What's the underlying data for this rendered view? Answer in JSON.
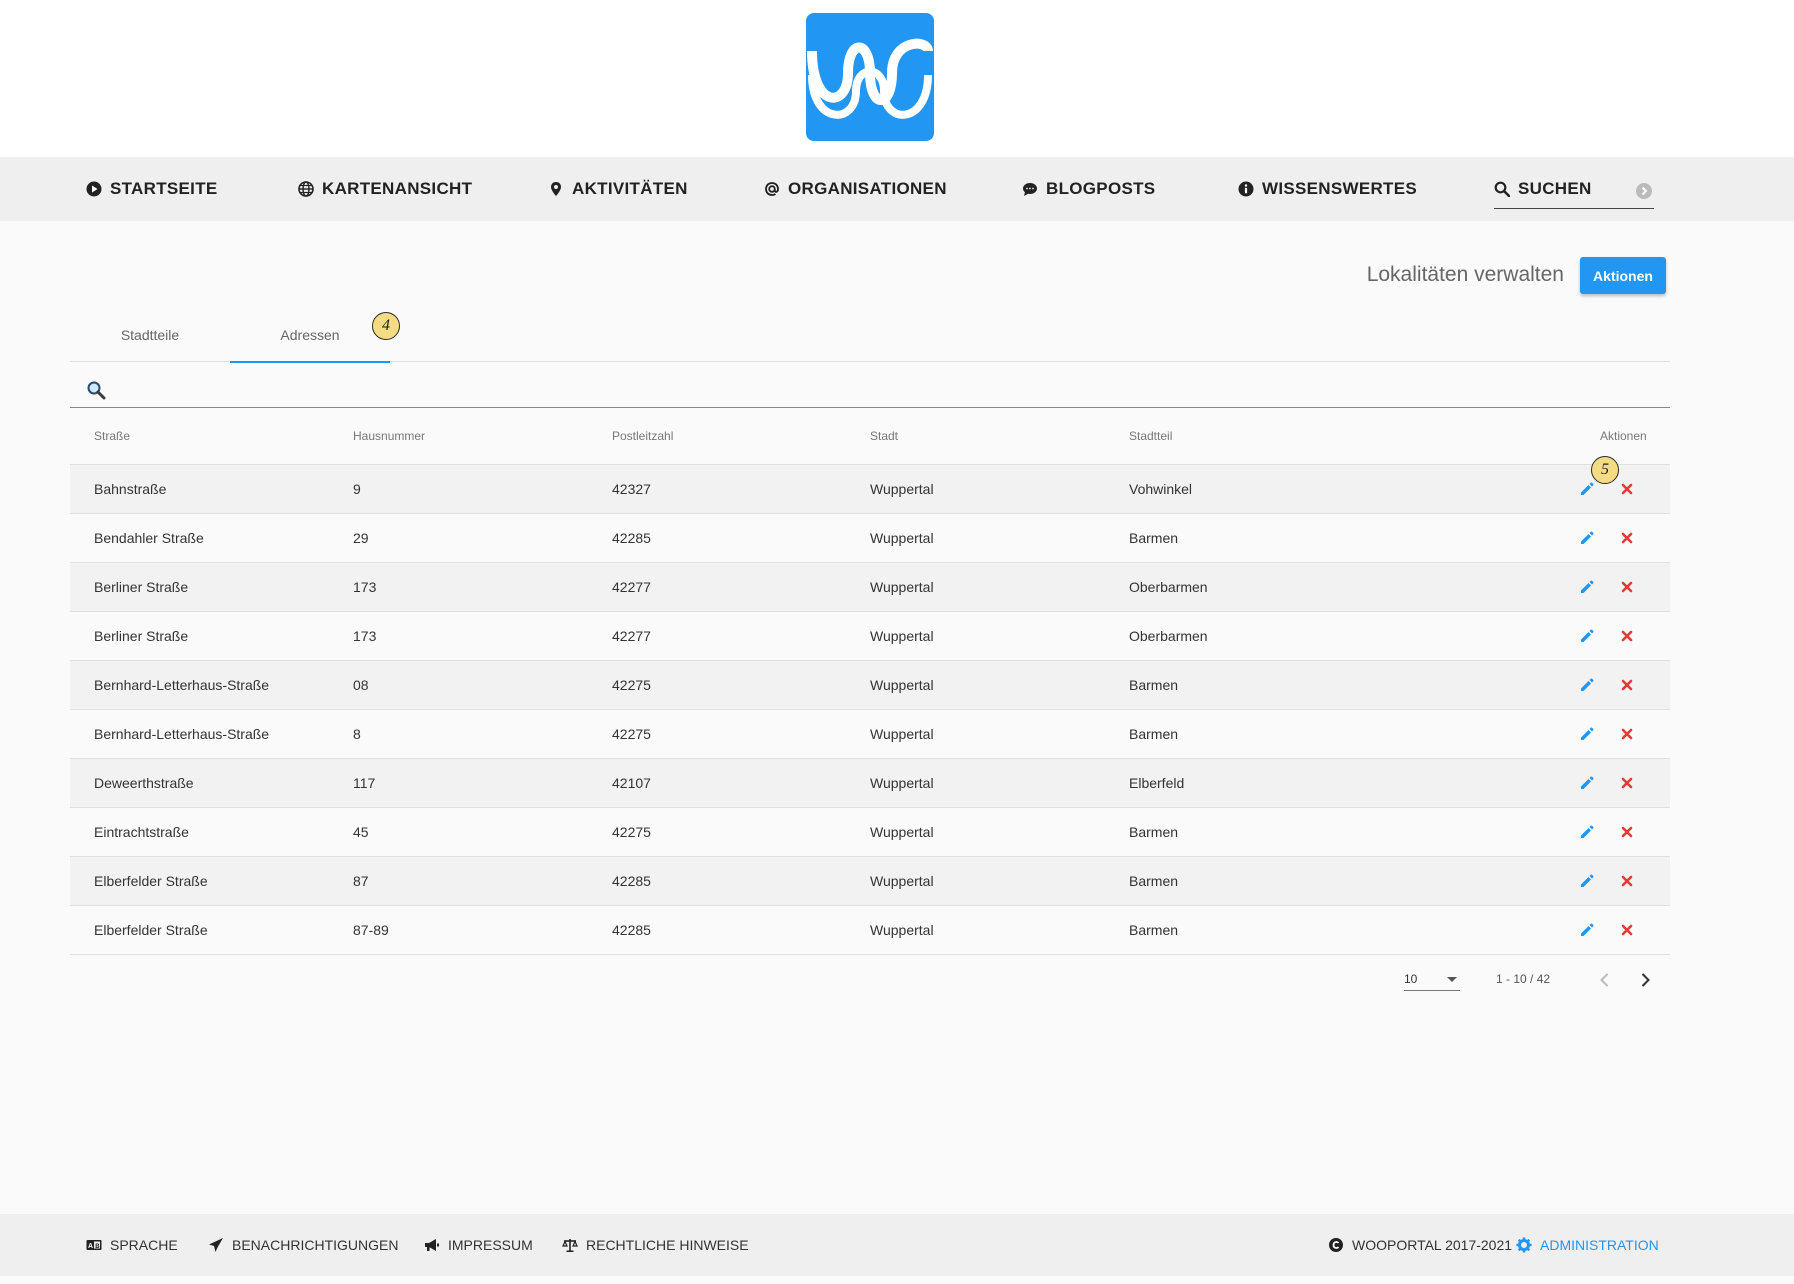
{
  "nav": {
    "start": "STARTSEITE",
    "map": "KARTENANSICHT",
    "activities": "AKTIVITÄTEN",
    "organisations": "ORGANISATIONEN",
    "blogposts": "BLOGPOSTS",
    "knowledge": "WISSENSWERTES",
    "search": "SUCHEN"
  },
  "header": {
    "title": "Lokalitäten verwalten",
    "actions_label": "Aktionen"
  },
  "tabs": {
    "districts": "Stadtteile",
    "addresses": "Adressen",
    "active": "Adressen"
  },
  "badges": {
    "tab_badge": "4",
    "actions_badge": "5"
  },
  "table": {
    "columns": {
      "street": "Straße",
      "number": "Hausnummer",
      "zip": "Postleitzahl",
      "city": "Stadt",
      "district": "Stadtteil",
      "actions": "Aktionen"
    },
    "rows": [
      {
        "street": "Bahnstraße",
        "number": "9",
        "zip": "42327",
        "city": "Wuppertal",
        "district": "Vohwinkel"
      },
      {
        "street": "Bendahler Straße",
        "number": "29",
        "zip": "42285",
        "city": "Wuppertal",
        "district": "Barmen"
      },
      {
        "street": "Berliner Straße",
        "number": "173",
        "zip": "42277",
        "city": "Wuppertal",
        "district": "Oberbarmen"
      },
      {
        "street": "Berliner Straße",
        "number": "173",
        "zip": "42277",
        "city": "Wuppertal",
        "district": "Oberbarmen"
      },
      {
        "street": "Bernhard-Letterhaus-Straße",
        "number": "08",
        "zip": "42275",
        "city": "Wuppertal",
        "district": "Barmen"
      },
      {
        "street": "Bernhard-Letterhaus-Straße",
        "number": "8",
        "zip": "42275",
        "city": "Wuppertal",
        "district": "Barmen"
      },
      {
        "street": "Deweerthstraße",
        "number": "117",
        "zip": "42107",
        "city": "Wuppertal",
        "district": "Elberfeld"
      },
      {
        "street": "Eintrachtstraße",
        "number": "45",
        "zip": "42275",
        "city": "Wuppertal",
        "district": "Barmen"
      },
      {
        "street": "Elberfelder Straße",
        "number": "87",
        "zip": "42285",
        "city": "Wuppertal",
        "district": "Barmen"
      },
      {
        "street": "Elberfelder Straße",
        "number": "87-89",
        "zip": "42285",
        "city": "Wuppertal",
        "district": "Barmen"
      }
    ]
  },
  "pagination": {
    "page_size": "10",
    "range": "1 - 10 / 42"
  },
  "footer": {
    "language": "SPRACHE",
    "notifications": "BENACHRICHTIGUNGEN",
    "imprint": "IMPRESSUM",
    "legal": "RECHTLICHE HINWEISE",
    "copyright": "WOOPORTAL 2017-2021",
    "admin": "ADMINISTRATION"
  },
  "colors": {
    "accent": "#2196f3",
    "delete": "#e53935",
    "nav_bg": "#efefef",
    "page_bg": "#fafafa"
  },
  "icons": {
    "edit": "pencil-icon",
    "delete": "close-icon",
    "search": "magnifier-icon"
  }
}
